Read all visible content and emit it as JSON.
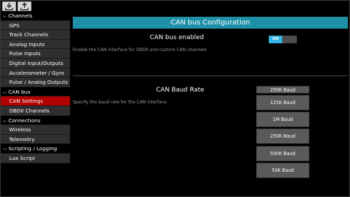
{
  "sidebar": {
    "items": [
      {
        "type": "group",
        "label": "Channels"
      },
      {
        "type": "item",
        "label": "GPS"
      },
      {
        "type": "item",
        "label": "Track Channels"
      },
      {
        "type": "item",
        "label": "Analog Inputs"
      },
      {
        "type": "item",
        "label": "Pulse Inputs"
      },
      {
        "type": "item",
        "label": "Digital Input/Outputs"
      },
      {
        "type": "item",
        "label": "Accelerometer / Gyro"
      },
      {
        "type": "item",
        "label": "Pulse / Analog Outputs"
      },
      {
        "type": "group",
        "label": "CAN bus"
      },
      {
        "type": "item",
        "label": "CAN Settings",
        "active": true
      },
      {
        "type": "item",
        "label": "OBDII Channels"
      },
      {
        "type": "group",
        "label": "Connections"
      },
      {
        "type": "item",
        "label": "Wireless"
      },
      {
        "type": "item",
        "label": "Telemetry"
      },
      {
        "type": "group",
        "label": "Scripting / Logging"
      },
      {
        "type": "item",
        "label": "Lua Script"
      }
    ]
  },
  "main": {
    "header": "CAN bus Configuration",
    "can_enabled": {
      "title": "CAN bus enabled",
      "description": "Enable the CAN interface for OBDII and custom CAN channels",
      "toggle_label": "ON"
    },
    "baud": {
      "title": "CAN Baud Rate",
      "description": "Specify the baud rate for the CAN interface",
      "options": [
        "250K Baud",
        "125K Baud",
        "1M Baud",
        "250K Baud",
        "500K Baud",
        "50K Baud"
      ]
    }
  },
  "colors": {
    "accent": "#1e90a8",
    "active_item": "#b30000",
    "toggle_on": "#33b5e5"
  }
}
